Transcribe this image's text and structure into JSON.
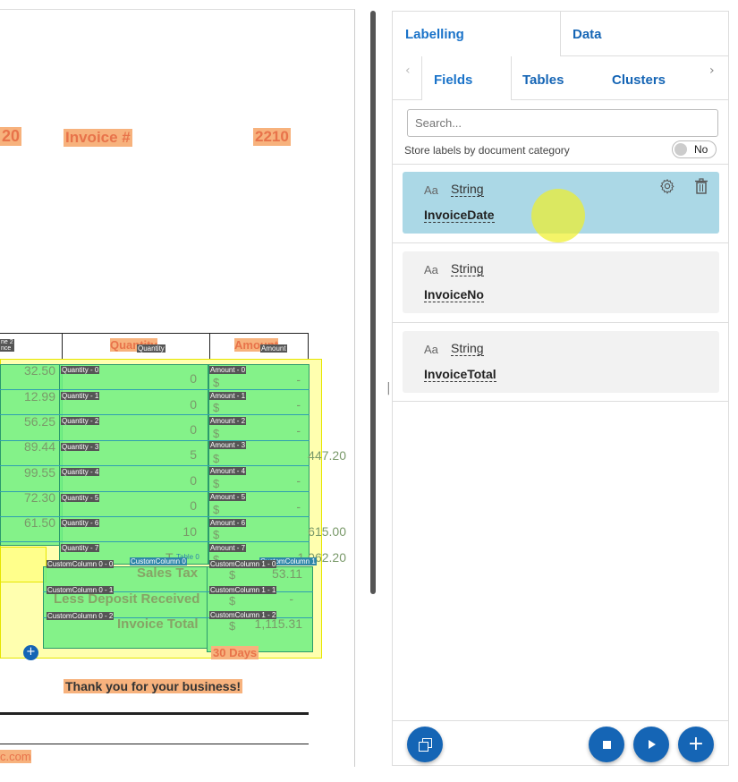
{
  "document": {
    "partial_date": "20",
    "invoice_label": "Invoice #",
    "invoice_number": "2210",
    "header_cut": "ne 2\nnce",
    "col_quantity": "Quantity",
    "col_amount": "Amount",
    "tag_quantity_header": "Quantity",
    "tag_amount_header": "Amount",
    "prices": [
      "32.50",
      "12.99",
      "56.25",
      "89.44",
      "99.55",
      "72.30",
      "61.50"
    ],
    "quantities": [
      "0",
      "0",
      "0",
      "5",
      "0",
      "0",
      "10"
    ],
    "amounts": [
      "-",
      "-",
      "-",
      "447.20",
      "-",
      "-",
      "615.00"
    ],
    "quantity_tags": [
      "Quantity - 0",
      "Quantity - 1",
      "Quantity - 2",
      "Quantity - 3",
      "Quantity - 4",
      "Quantity - 5",
      "Quantity - 6",
      "Quantity - 7"
    ],
    "amount_tags": [
      "Amount - 0",
      "Amount - 1",
      "Amount - 2",
      "Amount - 3",
      "Amount - 4",
      "Amount - 5",
      "Amount - 6",
      "Amount - 7"
    ],
    "dollar": "$",
    "subtotal_amount": "1,062.20",
    "total_label_cut": "T",
    "table_tag": "Table 0",
    "custom_col0_tag": "CustomColumn 0",
    "custom_col1_tag": "CustomColumn 1",
    "custom_tags_left": [
      "CustomColumn 0 - 0",
      "CustomColumn 0 - 1",
      "CustomColumn 0 - 2"
    ],
    "custom_tags_right": [
      "CustomColumn 1 - 0",
      "CustomColumn 1 - 1",
      "CustomColumn 1 - 2"
    ],
    "sales_tax_label": "Sales Tax",
    "sales_tax_value": "53.11",
    "deposit_label": "Less Deposit Received",
    "deposit_value": "-",
    "invoice_total_label": "Invoice Total",
    "invoice_total_value": "1,115.31",
    "days": "30  Days",
    "thanks": "Thank you for your business!",
    "footer_cut": "c.com",
    "add_glyph": "+"
  },
  "panel": {
    "tab_labelling": "Labelling",
    "tab_data": "Data",
    "subtab_fields": "Fields",
    "subtab_tables": "Tables",
    "subtab_clusters": "Clusters",
    "search_placeholder": "Search...",
    "store_labels": "Store labels by document category",
    "toggle_state": "No",
    "fields": [
      {
        "type_icon": "Aa",
        "type": "String",
        "name": "InvoiceDate"
      },
      {
        "type_icon": "Aa",
        "type": "String",
        "name": "InvoiceNo"
      },
      {
        "type_icon": "Aa",
        "type": "String",
        "name": "InvoiceTotal"
      }
    ]
  },
  "icons": {
    "prev": "chevron-left-icon",
    "next": "chevron-right-icon",
    "gear": "gear-icon",
    "trash": "trash-icon",
    "copy": "copy-icon",
    "stop": "stop-icon",
    "play": "play-icon",
    "plus": "plus-icon",
    "splitter": "drag-handle-icon"
  },
  "colors": {
    "accent": "#1565b5",
    "selected_card": "#abd8e6",
    "highlight": "#f7b27d"
  }
}
